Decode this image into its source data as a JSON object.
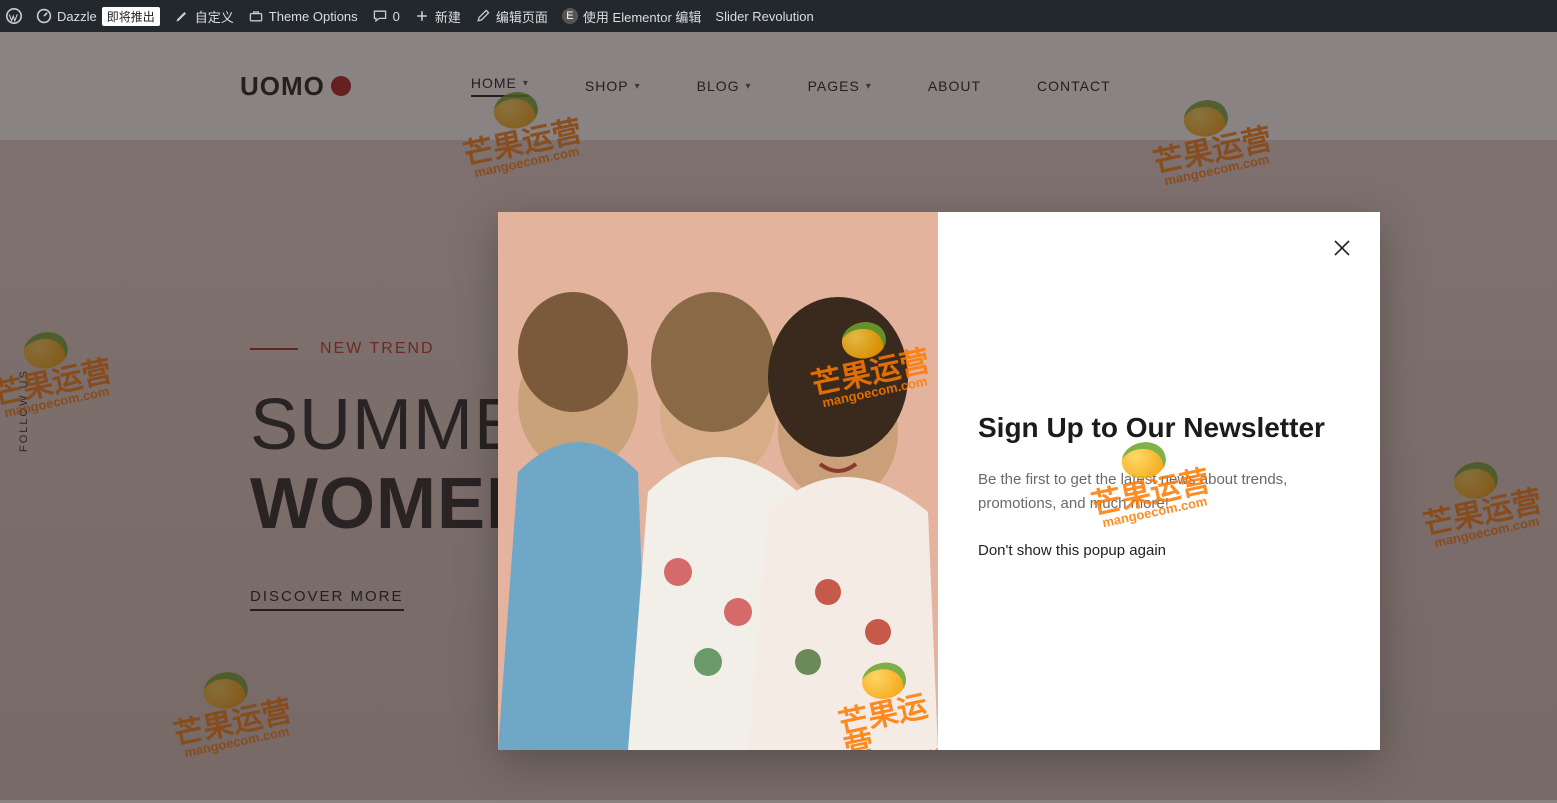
{
  "adminbar": {
    "site_name": "Dazzle",
    "coming_soon_badge": "即将推出",
    "customize": "自定义",
    "theme_options": "Theme Options",
    "comments_count": "0",
    "new": "新建",
    "edit_page": "编辑页面",
    "elementor": "使用 Elementor 编辑",
    "slider_revolution": "Slider Revolution"
  },
  "logo_text": "UOMO",
  "nav": {
    "home": "HOME",
    "shop": "SHOP",
    "blog": "BLOG",
    "pages": "PAGES",
    "about": "ABOUT",
    "contact": "CONTACT"
  },
  "hero": {
    "trend_label": "NEW TREND",
    "line1": "SUMMER SALE STYLISH",
    "line2": "WOMENS",
    "cta": "DISCOVER MORE"
  },
  "follow_us": "FOLLOW US",
  "watermark": {
    "title": "芒果运营",
    "sub": "mangoecom.com"
  },
  "modal": {
    "title": "Sign Up to Our Newsletter",
    "body": "Be the first to get the latest news about trends, promotions, and much more!",
    "dont_show": "Don't show this popup again"
  }
}
